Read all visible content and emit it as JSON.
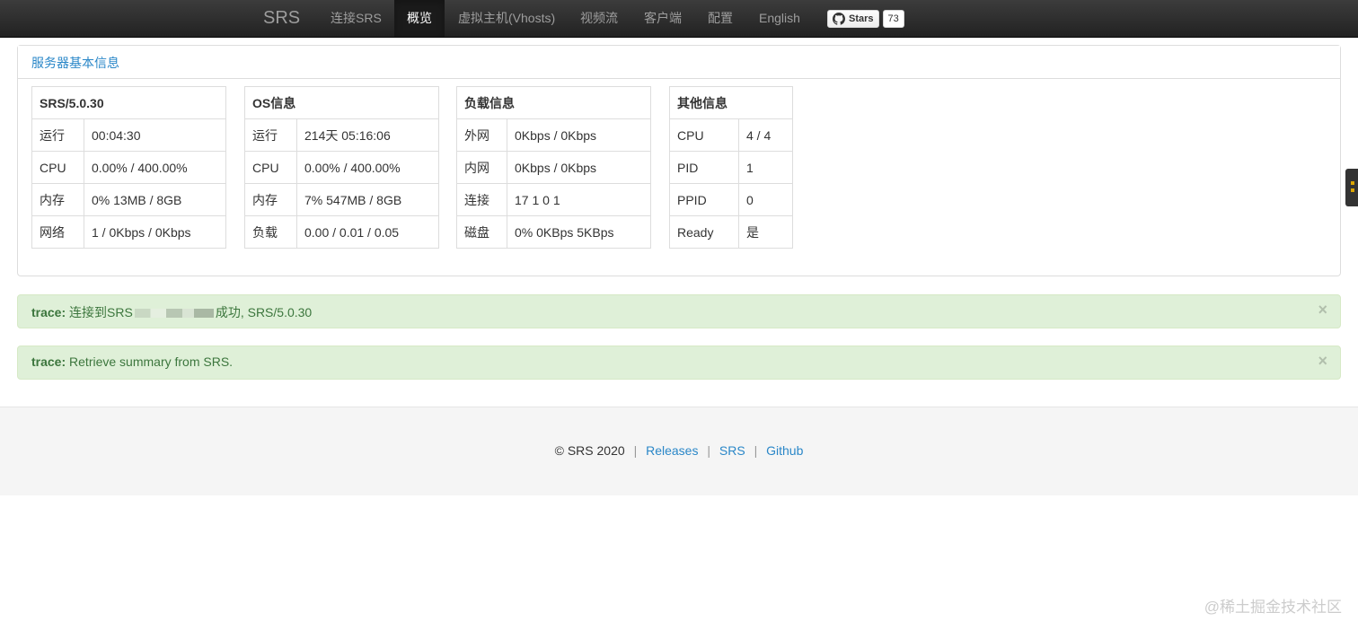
{
  "navbar": {
    "brand": "SRS",
    "items": [
      {
        "label": "连接SRS",
        "active": false
      },
      {
        "label": "概览",
        "active": true
      },
      {
        "label": "虚拟主机(Vhosts)",
        "active": false
      },
      {
        "label": "视频流",
        "active": false
      },
      {
        "label": "客户端",
        "active": false
      },
      {
        "label": "配置",
        "active": false
      },
      {
        "label": "English",
        "active": false
      }
    ],
    "github": {
      "label": "Stars",
      "count": "73",
      "icon": "github-icon"
    }
  },
  "panel": {
    "title": "服务器基本信息",
    "tables": [
      {
        "header": "SRS/5.0.30",
        "rows": [
          [
            "运行",
            "00:04:30"
          ],
          [
            "CPU",
            "0.00% / 400.00%"
          ],
          [
            "内存",
            "0% 13MB / 8GB"
          ],
          [
            "网络",
            "1 / 0Kbps / 0Kbps"
          ]
        ]
      },
      {
        "header": "OS信息",
        "rows": [
          [
            "运行",
            "214天 05:16:06"
          ],
          [
            "CPU",
            "0.00% / 400.00%"
          ],
          [
            "内存",
            "7% 547MB / 8GB"
          ],
          [
            "负载",
            "0.00 / 0.01 / 0.05"
          ]
        ]
      },
      {
        "header": "负载信息",
        "rows": [
          [
            "外网",
            "0Kbps / 0Kbps"
          ],
          [
            "内网",
            "0Kbps / 0Kbps"
          ],
          [
            "连接",
            "17 1 0 1"
          ],
          [
            "磁盘",
            "0% 0KBps 5KBps"
          ]
        ]
      },
      {
        "header": "其他信息",
        "rows": [
          [
            "CPU",
            "4 / 4"
          ],
          [
            "PID",
            "1"
          ],
          [
            "PPID",
            "0"
          ],
          [
            "Ready",
            "是"
          ]
        ]
      }
    ]
  },
  "alerts": [
    {
      "prefix": "trace:",
      "text_before": "连接到SRS",
      "text_after": "成功, SRS/5.0.30",
      "close": "×"
    },
    {
      "prefix": "trace:",
      "text": "Retrieve summary from SRS.",
      "close": "×"
    }
  ],
  "footer": {
    "copyright": "© SRS 2020",
    "links": [
      "Releases",
      "SRS",
      "Github"
    ],
    "separator": "|"
  },
  "watermark": "@稀土掘金技术社区",
  "colors": {
    "link": "#2a87c8",
    "alert_bg": "#dff0d8",
    "alert_text": "#3c763d",
    "navbar": "#222222"
  }
}
